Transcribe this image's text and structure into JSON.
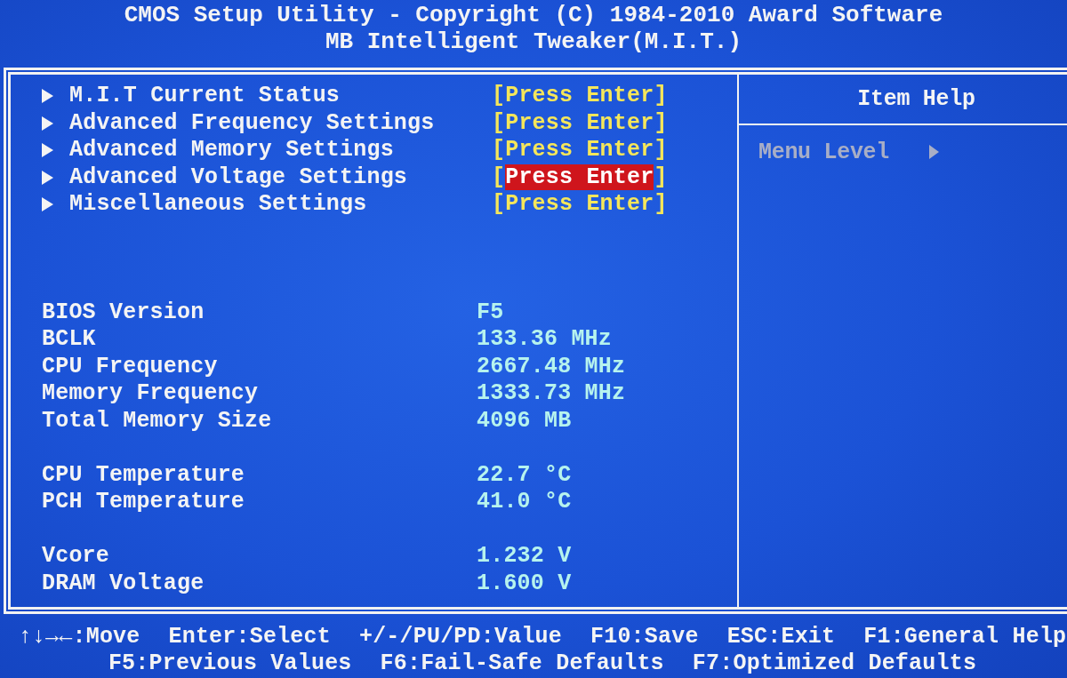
{
  "header": {
    "title": "CMOS Setup Utility - Copyright (C) 1984-2010 Award Software",
    "subtitle": "MB Intelligent Tweaker(M.I.T.)"
  },
  "menu": {
    "items": [
      {
        "label": "M.I.T Current Status",
        "open": "[",
        "value": "Press Enter",
        "close": "]",
        "selected": false
      },
      {
        "label": "Advanced Frequency Settings",
        "open": "[",
        "value": "Press Enter",
        "close": "]",
        "selected": false
      },
      {
        "label": "Advanced Memory Settings",
        "open": "[",
        "value": "Press Enter",
        "close": "]",
        "selected": false
      },
      {
        "label": "Advanced Voltage Settings",
        "open": "[",
        "value": "Press Enter",
        "close": "]",
        "selected": true
      },
      {
        "label": "Miscellaneous Settings",
        "open": "[",
        "value": "Press Enter",
        "close": "]",
        "selected": false
      }
    ]
  },
  "system_info": {
    "groups": [
      [
        {
          "label": "BIOS Version",
          "value": "F5"
        },
        {
          "label": "BCLK",
          "value": "133.36 MHz"
        },
        {
          "label": "CPU Frequency",
          "value": "2667.48 MHz"
        },
        {
          "label": "Memory Frequency",
          "value": "1333.73 MHz"
        },
        {
          "label": "Total Memory Size",
          "value": "4096 MB"
        }
      ],
      [
        {
          "label": "CPU Temperature",
          "value": "22.7 °C"
        },
        {
          "label": "PCH Temperature",
          "value": "41.0 °C"
        }
      ],
      [
        {
          "label": "Vcore",
          "value": "1.232 V"
        },
        {
          "label": "DRAM Voltage",
          "value": "1.600 V"
        }
      ]
    ]
  },
  "help_panel": {
    "title": "Item Help",
    "menu_level_label": "Menu Level"
  },
  "footer": {
    "lines": [
      [
        "↑↓→←:Move",
        "Enter:Select",
        "+/-/PU/PD:Value",
        "F10:Save",
        "ESC:Exit",
        "F1:General Help"
      ],
      [
        "F5:Previous Values",
        "F6:Fail-Safe Defaults",
        "F7:Optimized Defaults"
      ]
    ]
  }
}
